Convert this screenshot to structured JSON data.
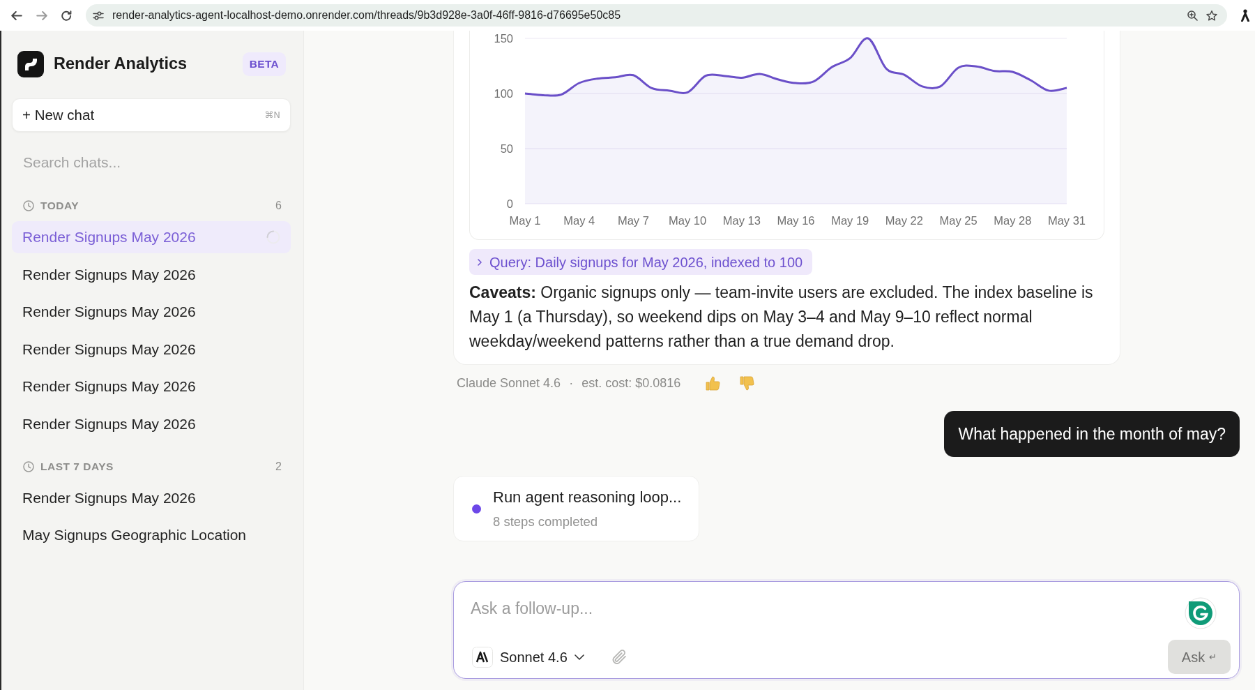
{
  "browser": {
    "url": "render-analytics-agent-localhost-demo.onrender.com/threads/9b3d928e-3a0f-46ff-9816-d76695e50c85"
  },
  "sidebar": {
    "app_name": "Render Analytics",
    "badge": "BETA",
    "new_chat": {
      "label": "+ New chat",
      "shortcut": "⌘N"
    },
    "search": {
      "placeholder": "Search chats..."
    },
    "groups": [
      {
        "label": "TODAY",
        "count": "6",
        "items": [
          {
            "title": "Render Signups May 2026",
            "selected": true,
            "loading": true
          },
          {
            "title": "Render Signups May 2026",
            "selected": false,
            "loading": false
          },
          {
            "title": "Render Signups May 2026",
            "selected": false,
            "loading": false
          },
          {
            "title": "Render Signups May 2026",
            "selected": false,
            "loading": false
          },
          {
            "title": "Render Signups May 2026",
            "selected": false,
            "loading": false
          },
          {
            "title": "Render Signups May 2026",
            "selected": false,
            "loading": false
          }
        ]
      },
      {
        "label": "LAST 7 DAYS",
        "count": "2",
        "items": [
          {
            "title": "Render Signups May 2026",
            "selected": false,
            "loading": false
          },
          {
            "title": "May Signups Geographic Location",
            "selected": false,
            "loading": false
          }
        ]
      }
    ]
  },
  "thread": {
    "assistant_message": {
      "chart_data": {
        "type": "area",
        "categories": [
          "May 1",
          null,
          null,
          "May 4",
          null,
          null,
          "May 7",
          null,
          null,
          "May 10",
          null,
          null,
          "May 13",
          null,
          null,
          "May 16",
          null,
          null,
          "May 19",
          null,
          null,
          "May 22",
          null,
          null,
          "May 25",
          null,
          null,
          "May 28",
          null,
          null,
          "May 31"
        ],
        "series": [
          {
            "color": "#6a4fc8",
            "values": [
              100,
              98.5,
              99,
              109.5,
              113.5,
              114.7,
              116.6,
              105,
              102.6,
              101,
              116,
              116,
              114.3,
              117.7,
              112.8,
              109.4,
              111,
              124,
              132,
              150,
              122.6,
              117,
              106.4,
              106.4,
              123.4,
              124.5,
              120.4,
              119.6,
              112,
              102.6,
              105
            ]
          }
        ],
        "ylim": [
          0,
          150
        ],
        "yticks": [
          0,
          50,
          100,
          150
        ]
      },
      "query": {
        "label": "Query: Daily signups for May 2026, indexed to 100",
        "expanded": false
      },
      "caveats": "**Caveats:** Organic signups only — team-invite users are excluded. The index baseline is May 1 (a Thursday), so weekend dips on May 3–4 and May 9–10 reflect normal weekday/weekend patterns rather than a true demand drop.",
      "meta": {
        "model": "Claude Sonnet 4.6",
        "separator": "·",
        "cost": "est. cost: $0.0816"
      }
    },
    "user_message": "What happened in the month of may?",
    "agent_step": {
      "title": "Run agent reasoning loop...",
      "subtitle": "8 steps completed",
      "color": "#6c47e8"
    }
  },
  "composer": {
    "placeholder": "Ask a follow-up...",
    "model": "Sonnet 4.6",
    "submit": {
      "label": "Ask",
      "shortcut": "↵",
      "disabled": true
    }
  }
}
